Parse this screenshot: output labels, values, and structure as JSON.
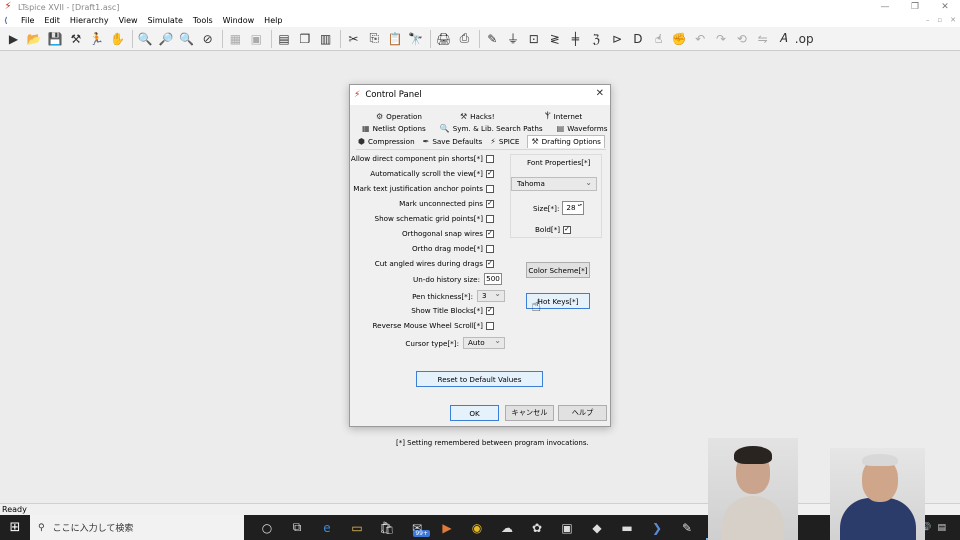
{
  "window": {
    "title": "LTspice XVII - [Draft1.asc]",
    "controls": [
      "—",
      "❐",
      "✕"
    ]
  },
  "menubar": {
    "items": [
      "File",
      "Edit",
      "Hierarchy",
      "View",
      "Simulate",
      "Tools",
      "Window",
      "Help"
    ],
    "mdi_controls": [
      "–",
      "▫",
      "✕"
    ]
  },
  "status": {
    "text": "Ready"
  },
  "taskbar": {
    "search_placeholder": "ここに入力して検索",
    "badge": "99+"
  },
  "dialog": {
    "title": "Control Panel",
    "tabs_row1": [
      "Operation",
      "Hacks!",
      "Internet"
    ],
    "tabs_row2": [
      "Netlist Options",
      "Sym. & Lib. Search Paths",
      "Waveforms"
    ],
    "tabs_row3": [
      "Compression",
      "Save Defaults",
      "SPICE",
      "Drafting Options"
    ],
    "options": [
      {
        "label": "Allow direct component pin shorts[*]",
        "checked": ""
      },
      {
        "label": "Automatically scroll the view[*]",
        "checked": "✓"
      },
      {
        "label": "Mark text justification anchor points",
        "checked": ""
      },
      {
        "label": "Mark unconnected pins",
        "checked": "✓"
      },
      {
        "label": "Show schematic grid points[*]",
        "checked": ""
      },
      {
        "label": "Orthogonal snap wires",
        "checked": "✓"
      },
      {
        "label": "Ortho drag mode[*]",
        "checked": ""
      },
      {
        "label": "Cut angled wires during drags",
        "checked": "✓"
      }
    ],
    "undo_label": "Un-do history size:",
    "undo_value": "500",
    "pen_label": "Pen thickness[*]:",
    "pen_value": "3",
    "title_blocks_label": "Show Title Blocks[*]",
    "title_blocks_checked": "✓",
    "reverse_scroll_label": "Reverse Mouse Wheel Scroll[*]",
    "reverse_scroll_checked": "",
    "cursor_label": "Cursor type[*]:",
    "cursor_value": "Auto",
    "font": {
      "title": "Font Properties[*]",
      "family": "Tahoma",
      "size_label": "Size[*]:",
      "size_value": "28",
      "bold_label": "Bold[*]",
      "bold_checked": "✓"
    },
    "color_button": "Color Scheme[*]",
    "hotkeys_button": "Hot Keys[*]",
    "note": "[*] Setting remembered between program invocations.",
    "reset_button": "Reset to Default Values",
    "ok_button": "OK",
    "cancel_button": "キャンセル",
    "help_button": "ヘルプ"
  }
}
